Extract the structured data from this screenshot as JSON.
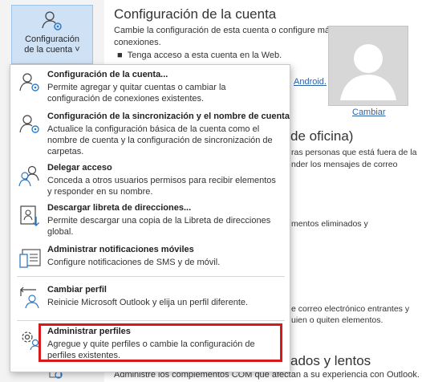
{
  "sidebar": {
    "account_button_line1": "Configuración",
    "account_button_line2": "de la cuenta"
  },
  "account_section": {
    "title": "Configuración de la cuenta",
    "desc_line1": "Cambie la configuración de esta cuenta o configure más",
    "desc_line2": "conexiones.",
    "bullet1": "Tenga acceso a esta cuenta en la Web.",
    "android_link": "Android.",
    "change_link": "Cambiar"
  },
  "bg_sections": {
    "ooo_title_fragment": "de oficina)",
    "ooo_desc_line1": "ras personas que está fuera de la",
    "ooo_desc_line2": "nder los mensajes de correo",
    "mailbox_fragment": "mentos eliminados y",
    "rules_line1": "e correo electrónico entrantes y",
    "rules_line2": "uien o quiten elementos.",
    "slow_title_fragment": "ados y lentos",
    "slow_desc": "Administre los complementos COM que afectan a su experiencia con Outlook."
  },
  "menu": {
    "items": [
      {
        "title": "Configuración de la cuenta...",
        "desc": "Permite agregar y quitar cuentas o cambiar la configuración de conexiones existentes."
      },
      {
        "title": "Configuración de la sincronización y el nombre de cuenta",
        "desc": "Actualice la configuración básica de la cuenta como el nombre de cuenta y la configuración de sincronización de carpetas."
      },
      {
        "title": "Delegar acceso",
        "desc": "Conceda a otros usuarios permisos para recibir elementos y responder en su nombre."
      },
      {
        "title": "Descargar libreta de direcciones...",
        "desc": "Permite descargar una copia de la Libreta de direcciones global."
      },
      {
        "title": "Administrar notificaciones móviles",
        "desc": "Configure notificaciones de SMS y de móvil."
      },
      {
        "title": "Cambiar perfil",
        "desc": "Reinicie Microsoft Outlook y elija un perfil diferente."
      },
      {
        "title": "Administrar perfiles",
        "desc": "Agregue y quite perfiles o cambie la configuración de perfiles existentes."
      }
    ]
  },
  "colors": {
    "accent": "#2e63a8",
    "highlight": "#d7191c",
    "selected_button": "#cfe1f4"
  }
}
